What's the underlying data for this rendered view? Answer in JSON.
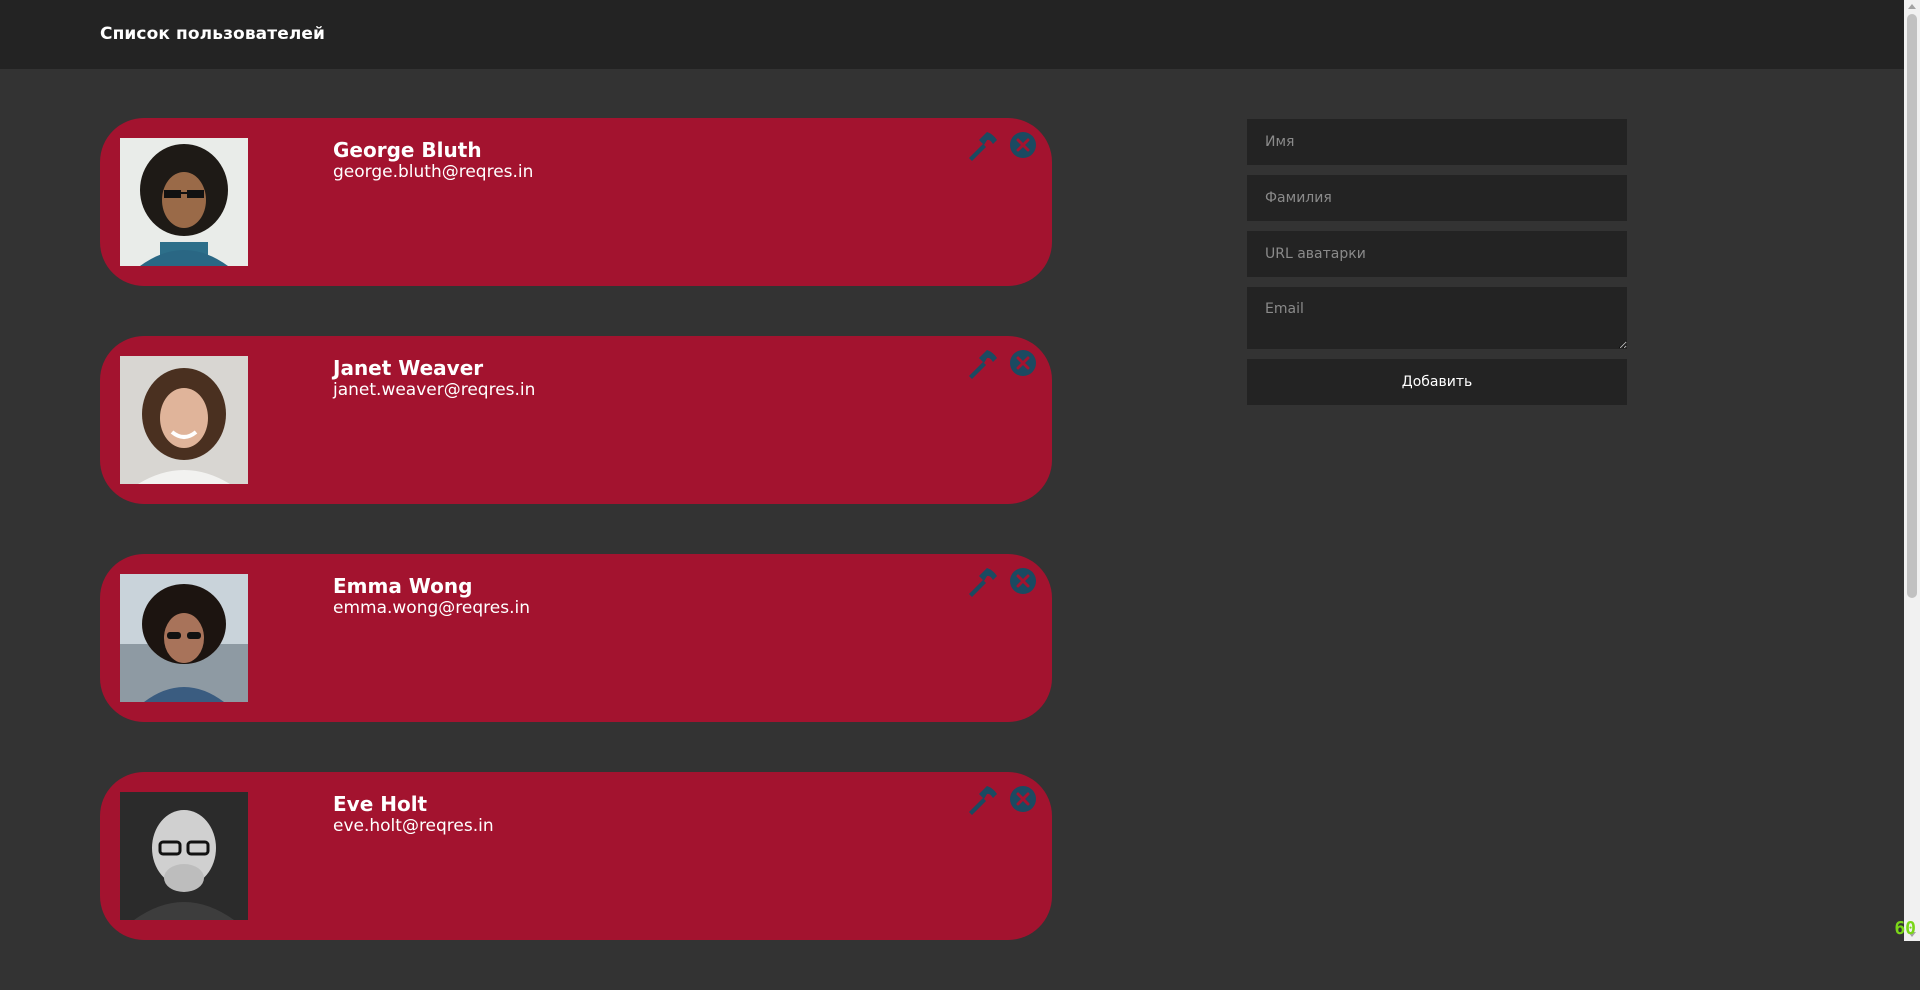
{
  "header": {
    "title": "Список пользователей"
  },
  "users": [
    {
      "name": "George Bluth",
      "email": "george.bluth@reqres.in"
    },
    {
      "name": "Janet Weaver",
      "email": "janet.weaver@reqres.in"
    },
    {
      "name": "Emma Wong",
      "email": "emma.wong@reqres.in"
    },
    {
      "name": "Eve Holt",
      "email": "eve.holt@reqres.in"
    }
  ],
  "form": {
    "first_name_placeholder": "Имя",
    "last_name_placeholder": "Фамилия",
    "avatar_url_placeholder": "URL аватарки",
    "email_placeholder": "Email",
    "submit_label": "Добавить"
  },
  "fps_counter": "60",
  "colors": {
    "background": "#333333",
    "header": "#232323",
    "card": "#a3132f",
    "icon": "#1b4a61",
    "fps": "#7ad619"
  },
  "icons": {
    "edit": "hammer-icon",
    "delete": "close-circle-icon"
  }
}
